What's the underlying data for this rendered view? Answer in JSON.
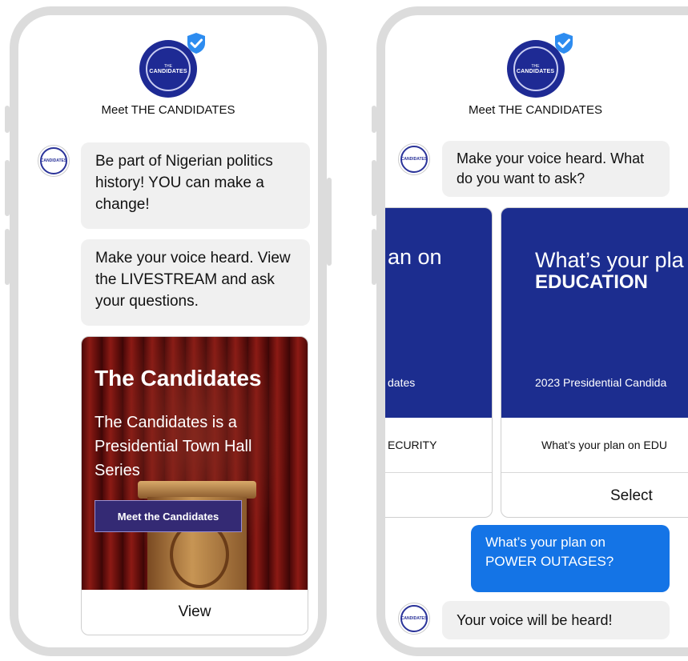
{
  "left_screen": {
    "header_title": "Meet THE CANDIDATES",
    "logo_text": "CANDIDATES",
    "logo_small": "THE",
    "messages": [
      "Be part of Nigerian politics history! YOU can make a change!",
      "Make your voice heard. View the LIVESTREAM and ask your questions."
    ],
    "card": {
      "heading": "The Candidates",
      "body": "The Candidates is a Presidential Town Hall Series",
      "button_label": "Meet the Candidates",
      "action_label": "View"
    }
  },
  "right_screen": {
    "header_title": "Meet THE CANDIDATES",
    "bot_message": "Make your voice heard. What do you want to ask?",
    "carousel": [
      {
        "head_line1": "an on",
        "sub": "dates",
        "caption": "ECURITY"
      },
      {
        "head_line1": "What’s your pla",
        "head_line2": "EDUCATION",
        "sub": "2023 Presidential Candida",
        "caption": "What’s your plan on EDU",
        "select_label": "Select"
      }
    ],
    "user_message": "What’s your plan on POWER OUTAGES?",
    "bot_reply": "Your voice will be heard!"
  },
  "colors": {
    "brand_navy": "#1e2a94",
    "promo_blue": "#1c2d8f",
    "user_bubble": "#1474e6",
    "bubble_grey": "#f0f0f0",
    "verified": "#2d8cf0"
  },
  "icons": [
    "verified-badge-icon",
    "candidates-logo",
    "bot-avatar"
  ]
}
